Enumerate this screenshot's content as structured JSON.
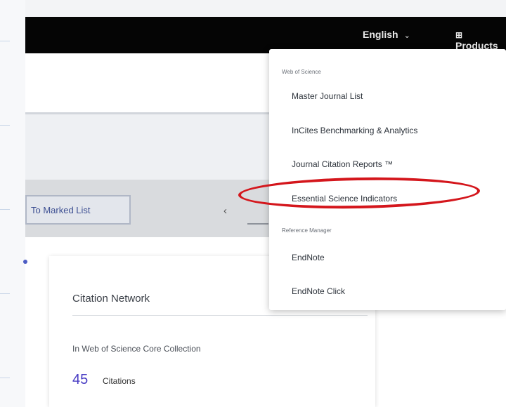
{
  "topbar": {
    "language": "English",
    "products": "Products"
  },
  "toolbar": {
    "marked_list_button": "To Marked List"
  },
  "card": {
    "title": "Citation Network",
    "collection": "In Web of Science Core Collection",
    "count": "45",
    "count_label": "Citations"
  },
  "menu": {
    "section1": "Web of Science",
    "items1": [
      "Master Journal List",
      "InCites Benchmarking & Analytics",
      "Journal Citation Reports ™",
      "Essential Science Indicators"
    ],
    "section2": "Reference Manager",
    "items2": [
      "EndNote",
      "EndNote Click"
    ]
  },
  "highlight": {
    "color": "#d4161c",
    "target": "Essential Science Indicators"
  }
}
